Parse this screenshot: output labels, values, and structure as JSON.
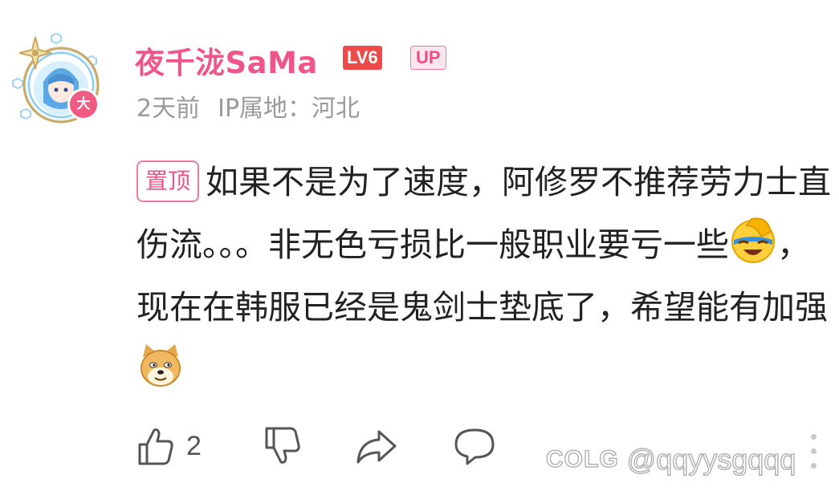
{
  "user": {
    "name": "夜千泷SaMa",
    "level": "LV6",
    "role_badge": "UP",
    "avatar_badge": "大",
    "name_color": "#f0558a"
  },
  "meta": {
    "time": "2天前",
    "ip_label": "IP属地：河北"
  },
  "comment": {
    "pin_tag": "置顶",
    "segments": [
      "如果不是为了速度，阿修罗不推荐劳力士直伤流。。。非无色亏损比一般职业要亏一些",
      "，现在在韩服已经是鬼剑士垫底了，希望能有加强"
    ],
    "emoji_1": "facepalm-laugh-emoji",
    "emoji_2": "doge-emoji"
  },
  "actions": {
    "like_count": "2",
    "icons": [
      "thumbs-up-icon",
      "thumbs-down-icon",
      "share-icon",
      "reply-icon",
      "more-icon"
    ]
  },
  "watermark": {
    "logo": "COLG",
    "handle": "@qqyysgqqq"
  },
  "colors": {
    "accent_pink": "#f0558a",
    "level_red": "#ef4a4a",
    "text": "#222222",
    "meta_gray": "#9a9a9a"
  }
}
